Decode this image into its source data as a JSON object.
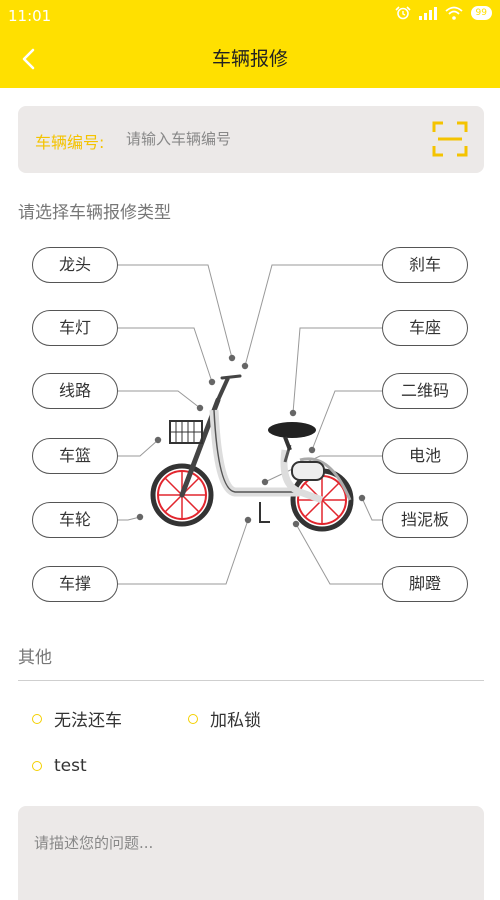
{
  "status_bar": {
    "time": "11:01",
    "battery": "99"
  },
  "header": {
    "title": "车辆报修"
  },
  "vin": {
    "label": "车辆编号:",
    "placeholder": "请输入车辆编号"
  },
  "repair_section": {
    "title": "请选择车辆报修类型",
    "left_parts": [
      "龙头",
      "车灯",
      "线路",
      "车篮",
      "车轮",
      "车撑"
    ],
    "right_parts": [
      "刹车",
      "车座",
      "二维码",
      "电池",
      "挡泥板",
      "脚蹬"
    ]
  },
  "other": {
    "title": "其他",
    "options": [
      "无法还车",
      "加私锁",
      "test"
    ]
  },
  "description": {
    "placeholder": "请描述您的问题..."
  },
  "colors": {
    "accent": "#FFE000",
    "label_yellow": "#F4C300",
    "wheel_red": "#E2262E"
  }
}
